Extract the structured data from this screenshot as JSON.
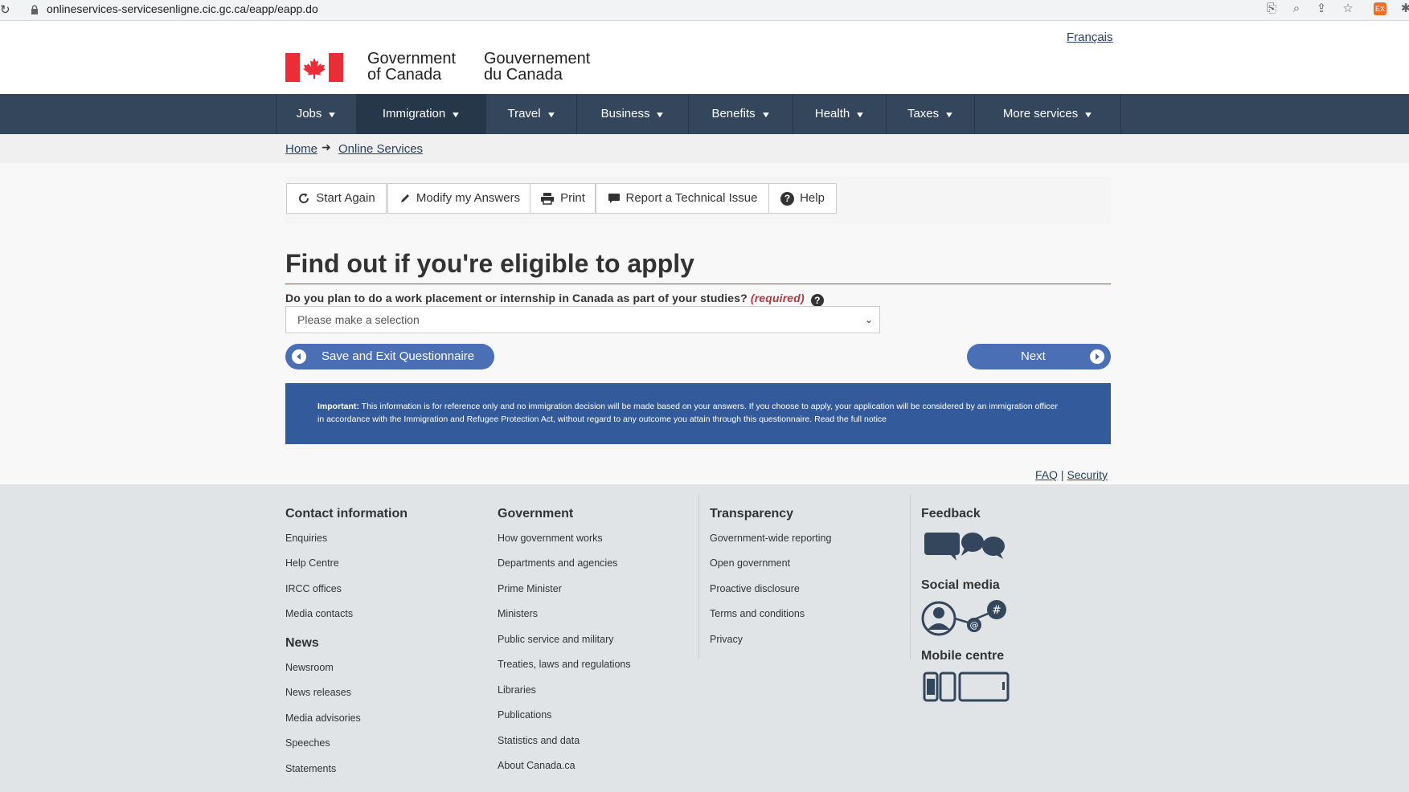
{
  "browser": {
    "url": "onlineservices-servicesenligne.cic.gc.ca/eapp/eapp.do"
  },
  "header": {
    "language_link": "Français",
    "gov_en_line1": "Government",
    "gov_en_line2": "of Canada",
    "gov_fr_line1": "Gouvernement",
    "gov_fr_line2": "du Canada"
  },
  "nav": {
    "items": [
      {
        "label": "Jobs"
      },
      {
        "label": "Immigration"
      },
      {
        "label": "Travel"
      },
      {
        "label": "Business"
      },
      {
        "label": "Benefits"
      },
      {
        "label": "Health"
      },
      {
        "label": "Taxes"
      },
      {
        "label": "More services"
      }
    ]
  },
  "breadcrumb": {
    "home": "Home",
    "current": "Online Services"
  },
  "toolbar": {
    "start_again": "Start Again",
    "modify": "Modify my Answers",
    "print": "Print",
    "report": "Report a Technical Issue",
    "help": "Help"
  },
  "main": {
    "title": "Find out if you're eligible to apply",
    "question": "Do you plan to do a work placement or internship in Canada as part of your studies?",
    "required": "(required)",
    "help_glyph": "?",
    "select_value": "Please make a selection",
    "save_exit": "Save and Exit Questionnaire",
    "next": "Next"
  },
  "notice": {
    "lead": "Important:",
    "text": " This information is for reference only and no immigration decision will be made based on your answers. If you choose to apply, your application will be considered by an immigration officer in accordance with the Immigration and Refugee Protection Act, without regard to any outcome you attain through this questionnaire. ",
    "link": "Read the full notice"
  },
  "utility": {
    "faq": "FAQ",
    "separator": "|",
    "security": "Security"
  },
  "footer": {
    "contact": {
      "title": "Contact information",
      "links": [
        "Enquiries",
        "Help Centre",
        "IRCC offices",
        "Media contacts"
      ]
    },
    "news": {
      "title": "News",
      "links": [
        "Newsroom",
        "News releases",
        "Media advisories",
        "Speeches",
        "Statements"
      ]
    },
    "government": {
      "title": "Government",
      "links": [
        "How government works",
        "Departments and agencies",
        "Prime Minister",
        "Ministers",
        "Public service and military",
        "Treaties, laws and regulations",
        "Libraries",
        "Publications",
        "Statistics and data",
        "About Canada.ca"
      ]
    },
    "transparency": {
      "title": "Transparency",
      "links": [
        "Government-wide reporting",
        "Open government",
        "Proactive disclosure",
        "Terms and conditions",
        "Privacy"
      ]
    },
    "feedback_title": "Feedback",
    "social_title": "Social media",
    "mobile_title": "Mobile centre"
  },
  "colors": {
    "nav_bg": "#33465c",
    "nav_active": "#26374a",
    "button_blue": "#4a6fb5",
    "notice_bg": "#335b9b",
    "flag_red": "#eb2d37",
    "required_red": "#af3c43"
  }
}
